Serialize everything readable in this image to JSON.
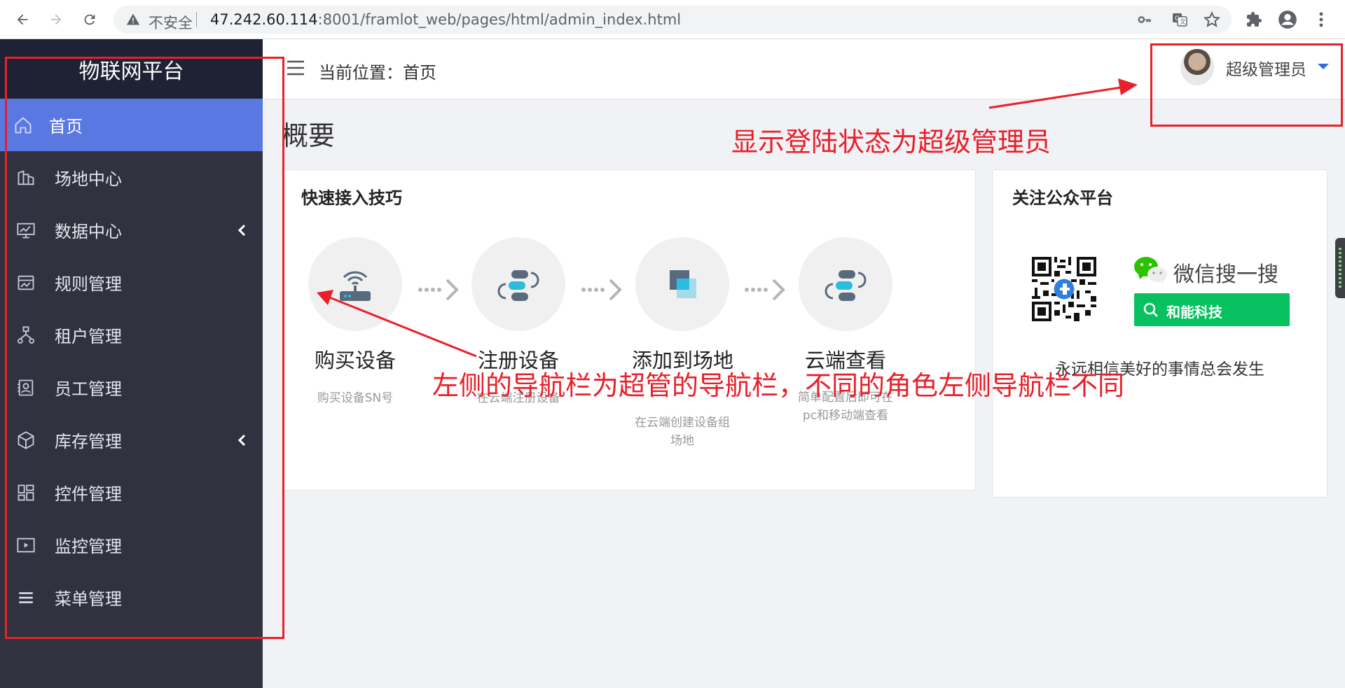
{
  "browser": {
    "insecure_label": "不安全",
    "url_host": "47.242.60.114",
    "url_rest": ":8001/framlot_web/pages/html/admin_index.html"
  },
  "sidebar": {
    "title": "物联网平台",
    "items": [
      {
        "label": "首页",
        "icon": "home-icon",
        "active": true
      },
      {
        "label": "场地中心",
        "icon": "building-icon"
      },
      {
        "label": "数据中心",
        "icon": "chart-monitor-icon",
        "has_arrow": true
      },
      {
        "label": "规则管理",
        "icon": "rule-icon"
      },
      {
        "label": "租户管理",
        "icon": "org-tree-icon"
      },
      {
        "label": "员工管理",
        "icon": "id-card-icon"
      },
      {
        "label": "库存管理",
        "icon": "box-icon",
        "has_arrow": true
      },
      {
        "label": "控件管理",
        "icon": "grid-widget-icon"
      },
      {
        "label": "监控管理",
        "icon": "video-play-icon"
      },
      {
        "label": "菜单管理",
        "icon": "list-menu-icon"
      }
    ]
  },
  "header": {
    "breadcrumb": "当前位置：首页",
    "username": "超级管理员"
  },
  "main": {
    "heading": "概要",
    "quick_card": {
      "title": "快速接入技巧",
      "steps": [
        {
          "title": "购买设备",
          "desc": "购买设备SN号",
          "icon": "router-icon"
        },
        {
          "title": "注册设备",
          "desc": "在云端注册设备",
          "icon": "link-register-icon"
        },
        {
          "title": "添加到场地",
          "desc": "在云端创建设备组场地",
          "icon": "layers-icon"
        },
        {
          "title": "云端查看",
          "desc": "简单配置后即可在pc和移动端查看",
          "icon": "cloud-view-icon"
        }
      ]
    },
    "follow_card": {
      "title": "关注公众平台",
      "wechat_label": "微信搜一搜",
      "search_text": "和能科技",
      "slogan": "永远相信美好的事情总会发生"
    }
  },
  "annotations": {
    "login_status": "显示登陆状态为超级管理员",
    "sidebar_note": "左侧的导航栏为超管的导航栏，不同的角色左侧导航栏不同"
  },
  "colors": {
    "sidebar_bg": "#30333f",
    "sidebar_title_bg": "#1f2234",
    "active_item": "#5a78e1",
    "annotation_red": "#e8202a",
    "wechat_green": "#07c160"
  }
}
